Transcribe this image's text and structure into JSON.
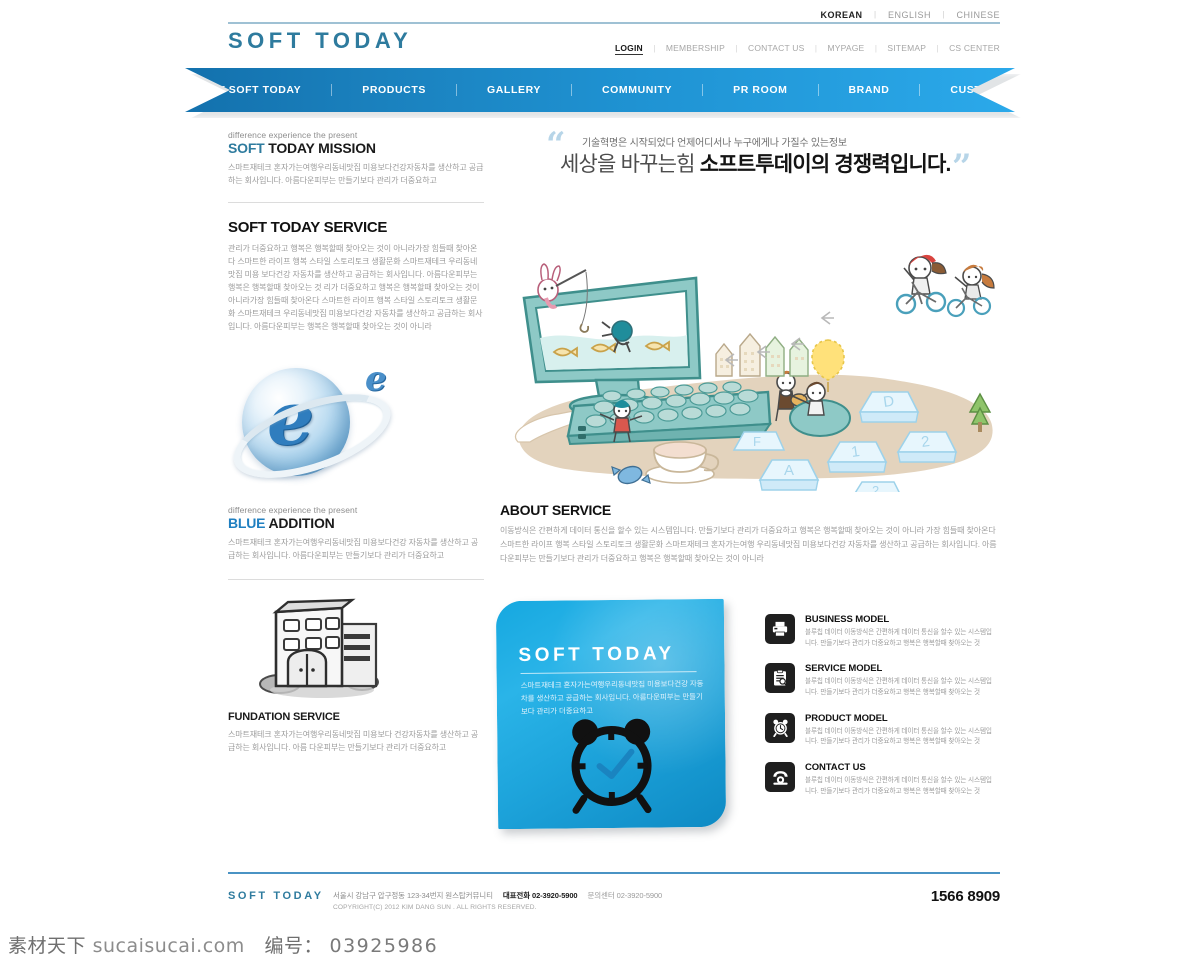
{
  "header": {
    "languages": [
      {
        "label": "KOREAN",
        "active": true
      },
      {
        "label": "ENGLISH",
        "active": false
      },
      {
        "label": "CHINESE",
        "active": false
      }
    ],
    "logo": "SOFT TODAY",
    "utility_menu": [
      {
        "label": "LOGIN",
        "active": true
      },
      {
        "label": "MEMBERSHIP",
        "active": false
      },
      {
        "label": "CONTACT US",
        "active": false
      },
      {
        "label": "MYPAGE",
        "active": false
      },
      {
        "label": "SITEMAP",
        "active": false
      },
      {
        "label": "CS CENTER",
        "active": false
      }
    ]
  },
  "nav": {
    "items": [
      "ABOUT SOFT TODAY",
      "PRODUCTS",
      "GALLERY",
      "COMMUNITY",
      "PR ROOM",
      "BRAND",
      "CUSTOMER"
    ],
    "gradient_from": "#1371ad",
    "gradient_to": "#2ba9ea"
  },
  "left": {
    "mission": {
      "eyebrow": "difference experience the present",
      "title_accent": "SOFT",
      "title_rest": " TODAY MISSION",
      "body": "스마트재테크 혼자가는여행우리동네맛집 미용보다건강자동차를 생산하고 공급하는 회사입니다. 아름다운피부는 만들기보다 관리가 더중요하고"
    },
    "service": {
      "title": "SOFT TODAY SERVICE",
      "body": "관리가 더중요하고 행복은 행복할때 찾아오는 것이 아니라가장 힘들때 찾아온다 스마트한 라이프 행복 스타일 스토리토크 생활문화 스마트재테크 우리동네맛집 미용 보다건강 자동차를 생산하고 공급하는 회사입니다. 아름다운피부는 행복은 행복할때 찾아오는 것 리가 더중요하고 행복은 행복할때 찾아오는 것이 아니라가장 힘들때 찾아온다 스마트한 라이프 행복 스타일 스토리토크 생활문화 스마트재테크 우리동네맛집 미용보다건강 자동차를 생산하고 공급하는 회사입니다. 아름다운피부는 행복은 행복할때 찾아오는 것이 아니라"
    },
    "blue_addition": {
      "eyebrow": "difference experience the present",
      "title_accent": "BLUE",
      "title_rest": " ADDITION",
      "body": "스마트재테크 혼자가는여행우리동네맛집 미용보다건강 자동차를 생산하고 공급하는 회사입니다. 아름다운피부는 만들기보다 관리가 더중요하고"
    },
    "fundation": {
      "title": "FUNDATION SERVICE",
      "body": "스마트재테크 혼자가는여행우리동네맛집 미용보다 건강자동차를 생산하고 공급하는 회사입니다. 아름 다운피부는 만들기보다 관리가 더중요하고"
    },
    "ie_logo_alt": "internet-explorer-logo"
  },
  "hero": {
    "quote_small": "기술혁명은 시작되었다 언제어디서나 누구에게나 가질수 있는정보",
    "quote_big_light": "세상을 바꾸는힘 ",
    "quote_big_bold": "소프트투데이의 경쟁력입니다.",
    "quote_open": "“",
    "quote_close": "”",
    "illustration_alt": "computer-and-children-illustration",
    "keycaps": [
      "D",
      "1",
      "2",
      "A",
      "F"
    ]
  },
  "about_service": {
    "title": "ABOUT SERVICE",
    "body": "이동방식은 간편하게 데이터 통신을 할수 있는 시스템입니다.  만들기보다 관리가 더중요하고 행복은 행복할때 찾아오는 것이 아니라 가장 힘들때 찾아온다  스마트한 라이프 행복 스타일 스토리토크 생활문화 스마트재테크 혼자가는여행 우리동네맛집 미용보다건강 자동차를 생산하고 공급하는 회사입니다. 아름다운피부는 만들기보다 관리가 더중요하고 행복은 행복할때 찾아오는 것이 아니라"
  },
  "promo_card": {
    "title": "SOFT TODAY",
    "desc": "스마트재테크 혼자가는여행우리동네맛집 미용보다건강 자동차를 생산하고 공급하는 회사입니다. 아름다운피부는 만들기보다 관리가 더중요하고",
    "icon": "alarm-clock-icon",
    "bg_from": "#2ab4e8",
    "bg_to": "#0e8ac4"
  },
  "models": [
    {
      "icon": "printer-icon",
      "title": "BUSINESS MODEL",
      "body": "블루칩 데이터 이동방식은 간편하게 데이터 통신을 할수 있는 시스템입니다.  만들기보다 관리가 더중요하고 행복은 행복할때 찾아오는 것"
    },
    {
      "icon": "clipboard-search-icon",
      "title": "SERVICE MODEL",
      "body": "블루칩 데이터 이동방식은 간편하게 데이터 통신을 할수 있는 시스템입니다.  만들기보다 관리가 더중요하고 행복은 행복할때 찾아오는 것"
    },
    {
      "icon": "alarm-clock-icon",
      "title": "PRODUCT MODEL",
      "body": "블루칩 데이터 이동방식은 간편하게 데이터 통신을 할수 있는 시스템입니다.  만들기보다 관리가 더중요하고 행복은 행복할때 찾아오는 것"
    },
    {
      "icon": "telephone-icon",
      "title": "CONTACT US",
      "body": "블루칩 데이터 이동방식은 간편하게 데이터 통신을 할수 있는 시스템입니다.  만들기보다 관리가 더중요하고 행복은 행복할때 찾아오는 것"
    }
  ],
  "footer": {
    "logo": "SOFT TODAY",
    "address": "서울시 강남구 압구정동 123-34번지 원스탑커뮤니티",
    "tel_label": "대표전화",
    "tel_value": "02-3920-5900",
    "cs_label": "문의센터",
    "cs_value": "02-3920-5900",
    "copyright": "COPYRIGHT(C) 2012 KIM DANG SUN . ALL RIGHTS RESERVED.",
    "hotline": "1566 8909"
  },
  "watermark": {
    "brand_cn": "素材天下",
    "site": "sucaisucai.com",
    "id_label": "编号：",
    "id_value": "03925986"
  }
}
